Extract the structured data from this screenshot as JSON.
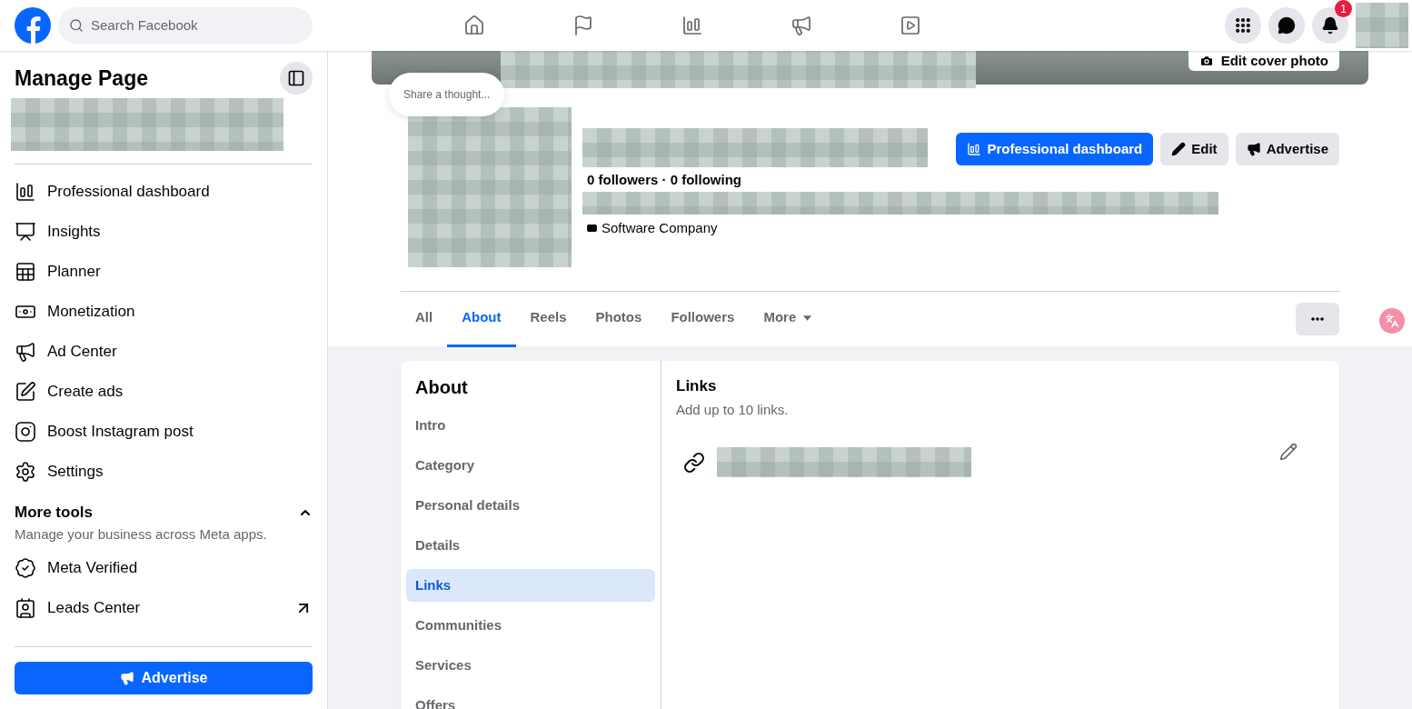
{
  "topbar": {
    "search": {
      "placeholder": "Search Facebook"
    },
    "notification_count": "1"
  },
  "sidebar": {
    "title": "Manage Page",
    "items": [
      {
        "label": "Professional dashboard"
      },
      {
        "label": "Insights"
      },
      {
        "label": "Planner"
      },
      {
        "label": "Monetization"
      },
      {
        "label": "Ad Center"
      },
      {
        "label": "Create ads"
      },
      {
        "label": "Boost Instagram post"
      },
      {
        "label": "Settings"
      }
    ],
    "more_tools": {
      "title": "More tools",
      "subtitle": "Manage your business across Meta apps.",
      "expanded": true,
      "items": [
        {
          "label": "Meta Verified",
          "external": false
        },
        {
          "label": "Leads Center",
          "external": true
        }
      ]
    },
    "advertise_button": "Advertise"
  },
  "profile": {
    "share_thought": "Share a thought...",
    "edit_cover": "Edit cover photo",
    "stats": "0 followers · 0 following",
    "category": "Software Company",
    "buttons": [
      {
        "kind": "primary",
        "label": "Professional dashboard"
      },
      {
        "kind": "edit",
        "label": "Edit"
      },
      {
        "kind": "advertise",
        "label": "Advertise"
      }
    ]
  },
  "tabs": [
    {
      "label": "All",
      "selected": false
    },
    {
      "label": "About",
      "selected": true
    },
    {
      "label": "Reels",
      "selected": false
    },
    {
      "label": "Photos",
      "selected": false
    },
    {
      "label": "Followers",
      "selected": false
    },
    {
      "label": "More",
      "selected": false
    }
  ],
  "about": {
    "title": "About",
    "sections": [
      {
        "label": "Intro",
        "selected": false
      },
      {
        "label": "Category",
        "selected": false
      },
      {
        "label": "Personal details",
        "selected": false
      },
      {
        "label": "Details",
        "selected": false
      },
      {
        "label": "Links",
        "selected": true
      },
      {
        "label": "Communities",
        "selected": false
      },
      {
        "label": "Services",
        "selected": false
      },
      {
        "label": "Offers",
        "selected": false
      }
    ],
    "panel": {
      "title": "Links",
      "subtitle": "Add up to 10 links."
    }
  }
}
